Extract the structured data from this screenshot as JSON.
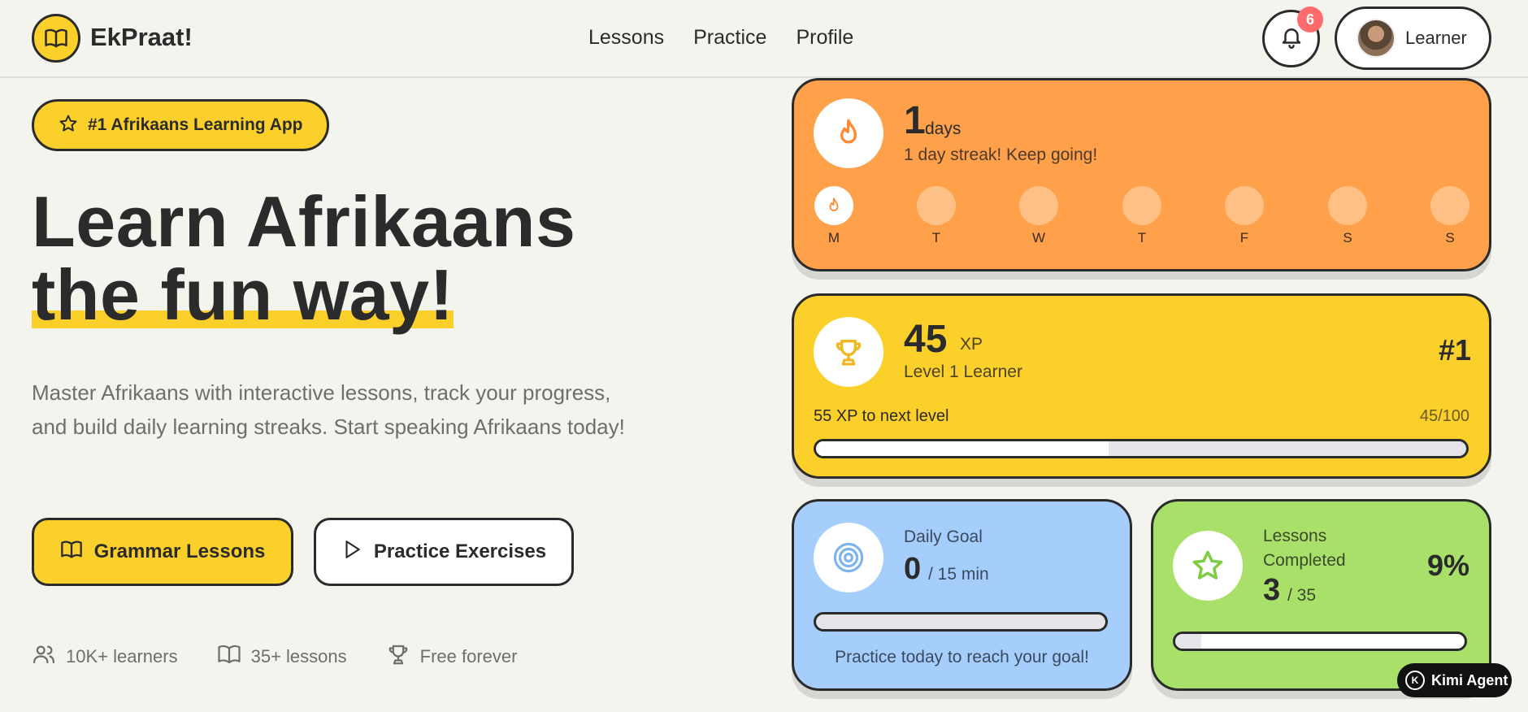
{
  "app": {
    "name": "EkPraat!"
  },
  "nav": {
    "items": [
      {
        "label": "Lessons"
      },
      {
        "label": "Practice"
      },
      {
        "label": "Profile"
      }
    ]
  },
  "notifications": {
    "count": "6"
  },
  "user": {
    "name": "Learner"
  },
  "hero": {
    "badge": "#1 Afrikaans Learning App",
    "title_line1": "Learn Afrikaans",
    "title_line2": "the fun way!",
    "description": "Master Afrikaans with interactive lessons, track your progress, and build daily learning streaks. Start speaking Afrikaans today!",
    "btn_primary": "Grammar Lessons",
    "btn_secondary": "Practice Exercises",
    "stats": [
      {
        "label": "10K+ learners"
      },
      {
        "label": "35+ lessons"
      },
      {
        "label": "Free forever"
      }
    ]
  },
  "streak": {
    "count": "1",
    "unit": "days",
    "message": "1 day streak! Keep going!",
    "days": [
      {
        "label": "M",
        "active": true
      },
      {
        "label": "T",
        "active": false
      },
      {
        "label": "W",
        "active": false
      },
      {
        "label": "T",
        "active": false
      },
      {
        "label": "F",
        "active": false
      },
      {
        "label": "S",
        "active": false
      },
      {
        "label": "S",
        "active": false
      }
    ]
  },
  "xp": {
    "value": "45",
    "unit": "XP",
    "level": "Level 1 Learner",
    "rank": "#1",
    "next_level": "55 XP to next level",
    "ratio": "45/100",
    "progress": 0.45
  },
  "daily_goal": {
    "title": "Daily Goal",
    "value": "0",
    "unit": "/ 15 min",
    "message": "Practice today to reach your goal!",
    "progress": 0
  },
  "lessons": {
    "title": "Lessons Completed",
    "value": "3",
    "unit": "/ 35",
    "percent": "9%",
    "progress": 0.09
  },
  "agent": {
    "label": "Kimi Agent"
  },
  "colors": {
    "accent": "#fcd02b",
    "streak_bg": "#ffa04a",
    "goal_bg": "#a6cefc",
    "lessons_bg": "#a8e06a",
    "notification": "#ff6b6b"
  },
  "icons": {
    "logo": "book-icon",
    "bell": "bell-icon",
    "badge": "star-icon",
    "primary_btn": "book-icon",
    "secondary_btn": "play-icon",
    "stat_learners": "users-icon",
    "stat_lessons": "book-icon",
    "stat_free": "trophy-icon",
    "streak": "flame-icon",
    "xp": "trophy-icon",
    "goal": "target-icon",
    "lessons": "star-icon"
  }
}
